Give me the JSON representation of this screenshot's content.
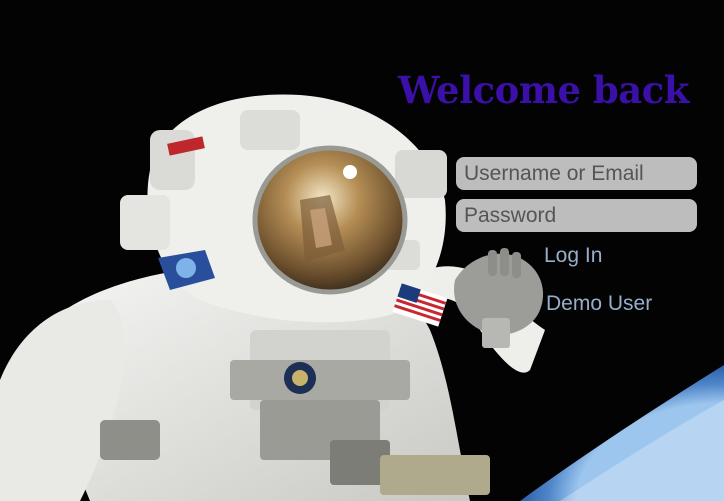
{
  "login": {
    "title": "Welcome back",
    "username_placeholder": "Username or Email",
    "password_placeholder": "Password",
    "login_label": "Log In",
    "demo_label": "Demo User"
  },
  "theme": {
    "title_color": "#3b10a8",
    "field_background": "#bdbdbd",
    "button_text_color": "#96aec9",
    "page_background": "#000000"
  },
  "icons": {
    "background": "astronaut-spacewalk-image"
  }
}
